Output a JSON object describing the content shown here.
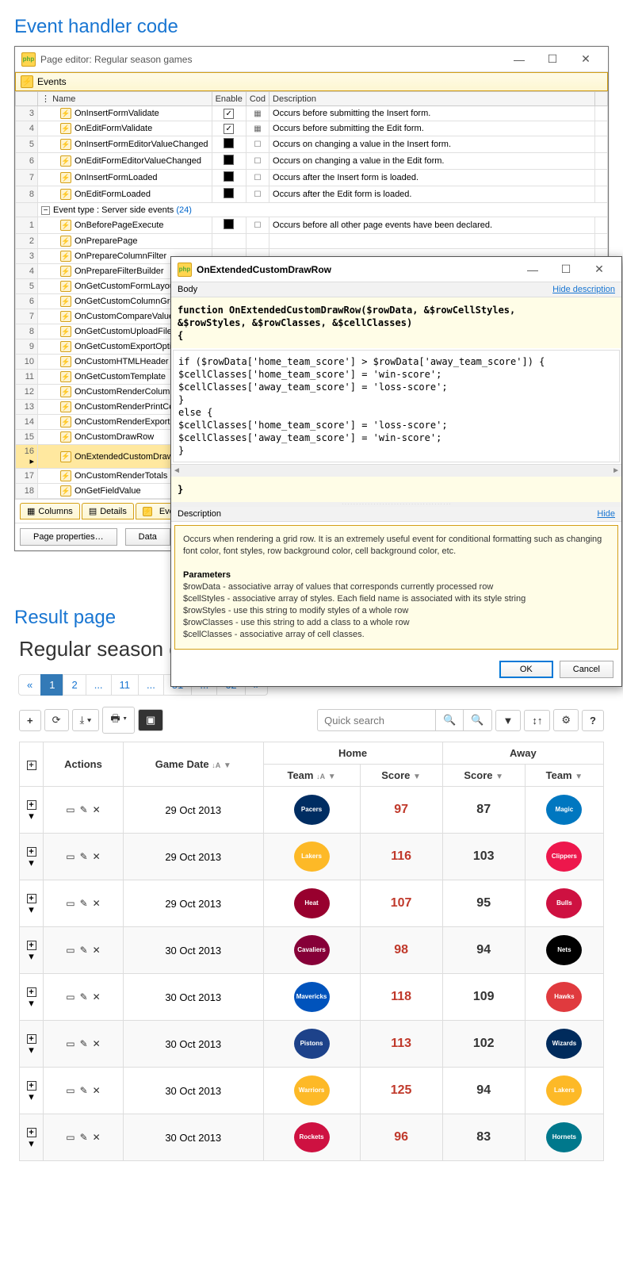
{
  "headings": {
    "event_handler": "Event handler code",
    "result_page": "Result page"
  },
  "page_editor": {
    "title": "Page editor: Regular season games",
    "events_panel": "Events",
    "columns": {
      "name": "Name",
      "enabled": "Enable",
      "code": "Cod",
      "description": "Description"
    },
    "client_events": [
      {
        "n": "3",
        "name": "OnInsertFormValidate",
        "check": "checked",
        "code": true,
        "desc": "Occurs before submitting the Insert form."
      },
      {
        "n": "4",
        "name": "OnEditFormValidate",
        "check": "checked",
        "code": true,
        "desc": "Occurs before submitting the Edit form."
      },
      {
        "n": "5",
        "name": "OnInsertFormEditorValueChanged",
        "check": "filled",
        "code": false,
        "desc": "Occurs on changing a value in the Insert form."
      },
      {
        "n": "6",
        "name": "OnEditFormEditorValueChanged",
        "check": "filled",
        "code": false,
        "desc": "Occurs on changing a value in the Edit form."
      },
      {
        "n": "7",
        "name": "OnInsertFormLoaded",
        "check": "filled",
        "code": false,
        "desc": "Occurs after the Insert form is loaded."
      },
      {
        "n": "8",
        "name": "OnEditFormLoaded",
        "check": "filled",
        "code": false,
        "desc": "Occurs after the Edit form is loaded."
      }
    ],
    "group_label": "Event type : Server side events",
    "group_count": "(24)",
    "server_events": [
      {
        "n": "1",
        "name": "OnBeforePageExecute",
        "check": "filled",
        "code": false,
        "desc": "Occurs before all other page events have been declared."
      },
      {
        "n": "2",
        "name": "OnPreparePage"
      },
      {
        "n": "3",
        "name": "OnPrepareColumnFilter"
      },
      {
        "n": "4",
        "name": "OnPrepareFilterBuilder"
      },
      {
        "n": "5",
        "name": "OnGetCustomFormLayout"
      },
      {
        "n": "6",
        "name": "OnGetCustomColumnGroup"
      },
      {
        "n": "7",
        "name": "OnCustomCompareValues"
      },
      {
        "n": "8",
        "name": "OnGetCustomUploadFileName"
      },
      {
        "n": "9",
        "name": "OnGetCustomExportOptions"
      },
      {
        "n": "10",
        "name": "OnCustomHTMLHeader"
      },
      {
        "n": "11",
        "name": "OnGetCustomTemplate"
      },
      {
        "n": "12",
        "name": "OnCustomRenderColumn"
      },
      {
        "n": "13",
        "name": "OnCustomRenderPrintColumn"
      },
      {
        "n": "14",
        "name": "OnCustomRenderExportColumn"
      },
      {
        "n": "15",
        "name": "OnCustomDrawRow"
      },
      {
        "n": "16",
        "name": "OnExtendedCustomDrawRow",
        "sel": true
      },
      {
        "n": "17",
        "name": "OnCustomRenderTotals"
      },
      {
        "n": "18",
        "name": "OnGetFieldValue"
      }
    ],
    "tabs": [
      "Columns",
      "Details",
      "Events"
    ],
    "buttons": [
      "Page properties…",
      "Data"
    ]
  },
  "dialog": {
    "title": "OnExtendedCustomDrawRow",
    "body_label": "Body",
    "hide_desc": "Hide description",
    "sig1": "function OnExtendedCustomDrawRow($rowData, &$rowCellStyles,",
    "sig2": "&$rowStyles, &$rowClasses, &$cellClasses)",
    "code": [
      "if ($rowData['home_team_score'] > $rowData['away_team_score']) {",
      "      $cellClasses['home_team_score'] = 'win-score';",
      "      $cellClasses['away_team_score'] = 'loss-score';",
      "}",
      "else {",
      "      $cellClasses['home_team_score'] = 'loss-score';",
      "      $cellClasses['away_team_score'] = 'win-score';",
      "}"
    ],
    "desc_label": "Description",
    "hide": "Hide",
    "desc_text": "Occurs when rendering a grid row. It is an extremely useful event for conditional formatting such as changing font color, font styles, row background color, cell background color, etc.",
    "params_label": "Parameters",
    "params": [
      "$rowData - associative array of values that corresponds currently processed row",
      "$cellStyles - associative array of styles. Each field name is associated with its style string",
      "$rowStyles - use this string to modify styles of a whole row",
      "$rowClasses - use this string to add a class to a whole row",
      "$cellClasses - associative array of cell classes."
    ],
    "ok": "OK",
    "cancel": "Cancel"
  },
  "result": {
    "title": "Regular season games",
    "pages": [
      "«",
      "1",
      "2",
      "...",
      "11",
      "...",
      "51",
      "...",
      "62",
      "»"
    ],
    "active_page": "1",
    "search_placeholder": "Quick search",
    "headers": {
      "actions": "Actions",
      "date": "Game Date",
      "home": "Home",
      "away": "Away",
      "team": "Team",
      "score": "Score"
    },
    "rows": [
      {
        "date": "29 Oct 2013",
        "hteam": "Pacers",
        "hcolor": "#002d62",
        "hs": "97",
        "as": "87",
        "ateam": "Magic",
        "acolor": "#0077c0"
      },
      {
        "date": "29 Oct 2013",
        "hteam": "Lakers",
        "hcolor": "#fdb927",
        "hs": "116",
        "as": "103",
        "ateam": "Clippers",
        "acolor": "#ed174c"
      },
      {
        "date": "29 Oct 2013",
        "hteam": "Heat",
        "hcolor": "#98002e",
        "hs": "107",
        "as": "95",
        "ateam": "Bulls",
        "acolor": "#ce1141"
      },
      {
        "date": "30 Oct 2013",
        "hteam": "Cavaliers",
        "hcolor": "#860038",
        "hs": "98",
        "as": "94",
        "ateam": "Nets",
        "acolor": "#000"
      },
      {
        "date": "30 Oct 2013",
        "hteam": "Mavericks",
        "hcolor": "#0053bc",
        "hs": "118",
        "as": "109",
        "ateam": "Hawks",
        "acolor": "#e03a3e"
      },
      {
        "date": "30 Oct 2013",
        "hteam": "Pistons",
        "hcolor": "#1d428a",
        "hs": "113",
        "as": "102",
        "ateam": "Wizards",
        "acolor": "#002b5c"
      },
      {
        "date": "30 Oct 2013",
        "hteam": "Warriors",
        "hcolor": "#fdb927",
        "hs": "125",
        "as": "94",
        "ateam": "Lakers",
        "acolor": "#fdb927"
      },
      {
        "date": "30 Oct 2013",
        "hteam": "Rockets",
        "hcolor": "#ce1141",
        "hs": "96",
        "as": "83",
        "ateam": "Hornets",
        "acolor": "#00788c"
      }
    ]
  }
}
